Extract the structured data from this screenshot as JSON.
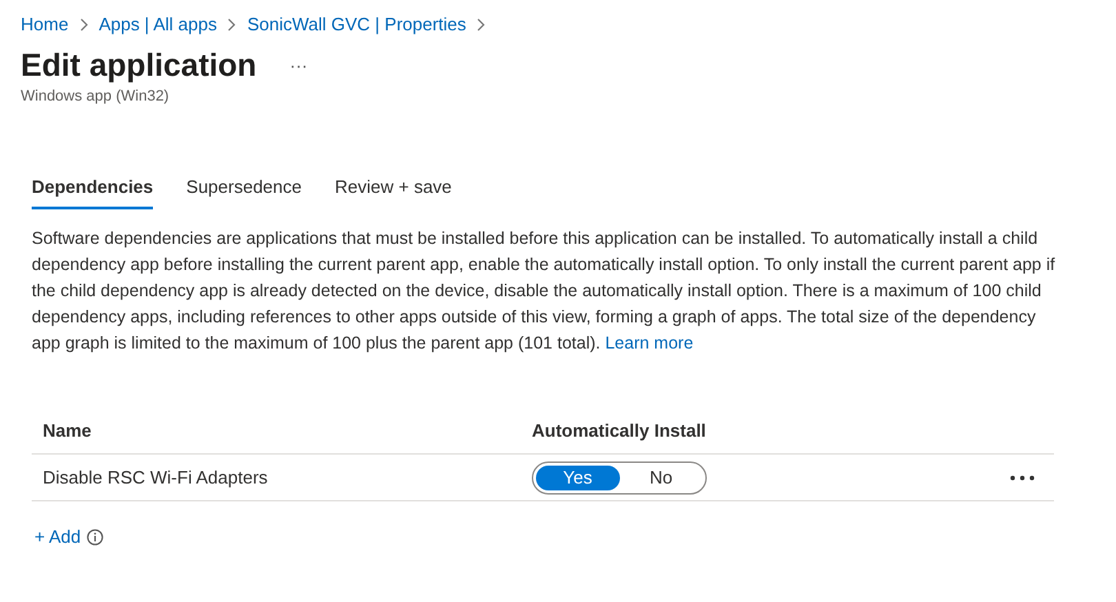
{
  "breadcrumb": [
    "Home",
    "Apps | All apps",
    "SonicWall GVC | Properties"
  ],
  "header": {
    "title": "Edit application",
    "more": "···",
    "subtitle": "Windows app (Win32)"
  },
  "tabs": [
    {
      "label": "Dependencies",
      "selected": true
    },
    {
      "label": "Supersedence",
      "selected": false
    },
    {
      "label": "Review + save",
      "selected": false
    }
  ],
  "description": "Software dependencies are applications that must be installed before this application can be installed. To automatically install a child dependency app before installing the current parent app, enable the automatically install option. To only install the current parent app if the child dependency app is already detected on the device, disable the automatically install option. There is a maximum of 100 child dependency apps, including references to other apps outside of this view, forming a graph of apps. The total size of the dependency app graph is limited to the maximum of 100 plus the parent app (101 total).",
  "learn_more": "Learn more",
  "table": {
    "columns": [
      "Name",
      "Automatically Install"
    ],
    "rows": [
      {
        "name": "Disable RSC Wi-Fi Adapters",
        "options": [
          {
            "label": "Yes",
            "selected": true
          },
          {
            "label": "No",
            "selected": false
          }
        ]
      }
    ]
  },
  "add": "+ Add"
}
